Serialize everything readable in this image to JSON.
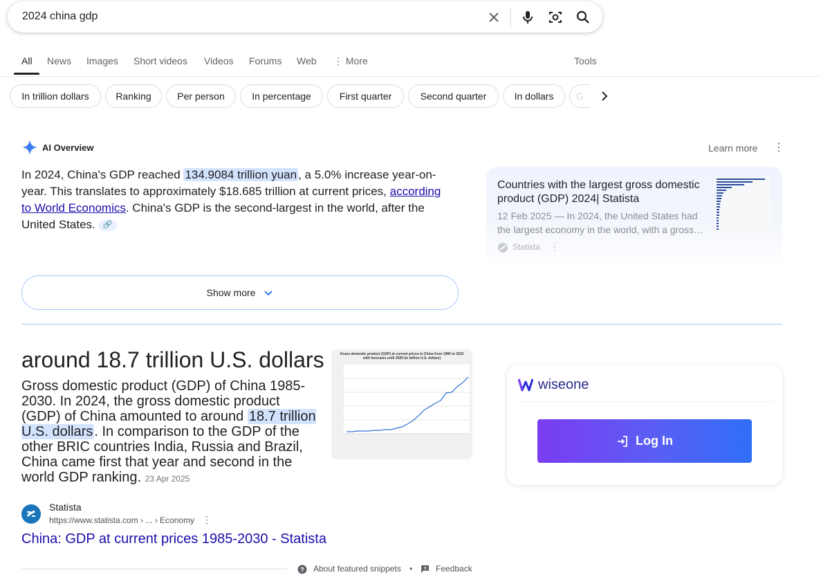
{
  "search": {
    "query": "2024 china gdp"
  },
  "tabs": [
    {
      "label": "All"
    },
    {
      "label": "News"
    },
    {
      "label": "Images"
    },
    {
      "label": "Short videos"
    },
    {
      "label": "Videos"
    },
    {
      "label": "Forums"
    },
    {
      "label": "Web"
    },
    {
      "label": "More"
    }
  ],
  "tools_label": "Tools",
  "chips": [
    "In trillion dollars",
    "Ranking",
    "Per person",
    "In percentage",
    "First quarter",
    "Second quarter",
    "In dollars",
    "G"
  ],
  "ai_overview": {
    "title": "AI Overview",
    "learn_more": "Learn more",
    "text_1": "In 2024, China's GDP reached ",
    "highlight": "134.9084 trillion yuan",
    "text_2": ", a 5.0% increase year-on-year. This translates to approximately $18.685 trillion at current prices, ",
    "link": "according to World Economics",
    "text_3": ". China's GDP is the second-largest in the world, after the United States. ",
    "show_more": "Show more",
    "source_card": {
      "title": "Countries with the largest gross domestic product (GDP) 2024| Statista",
      "snippet": "12 Feb 2025 — In 2024, the United States had the largest economy in the world, with a gross…",
      "site": "Statista"
    }
  },
  "featured": {
    "answer": "around 18.7 trillion U.S. dollars",
    "text_1": "Gross domestic product (GDP) of China 1985-2030. In 2024, the gross domestic product (GDP) of China amounted to around ",
    "highlight": "18.7 trillion U.S. dollars",
    "text_2": ". In comparison to the GDP of the other BRIC countries India, Russia and Brazil, China came first that year and second in the world GDP ranking.",
    "date": "23 Apr 2025",
    "site_name": "Statista",
    "site_url": "https://www.statista.com › ... › Economy",
    "result_title": "China: GDP at current prices 1985-2030 - Statista",
    "thumb_title": "Gross domestic product (GDP) at current prices in China from 1985 to 2023 with forecasts until 2029 (in billion U.S. dollars)"
  },
  "footer": {
    "about": "About featured snippets",
    "feedback": "Feedback"
  },
  "wiseone": {
    "brand": "wiseone",
    "login": "Log In"
  }
}
